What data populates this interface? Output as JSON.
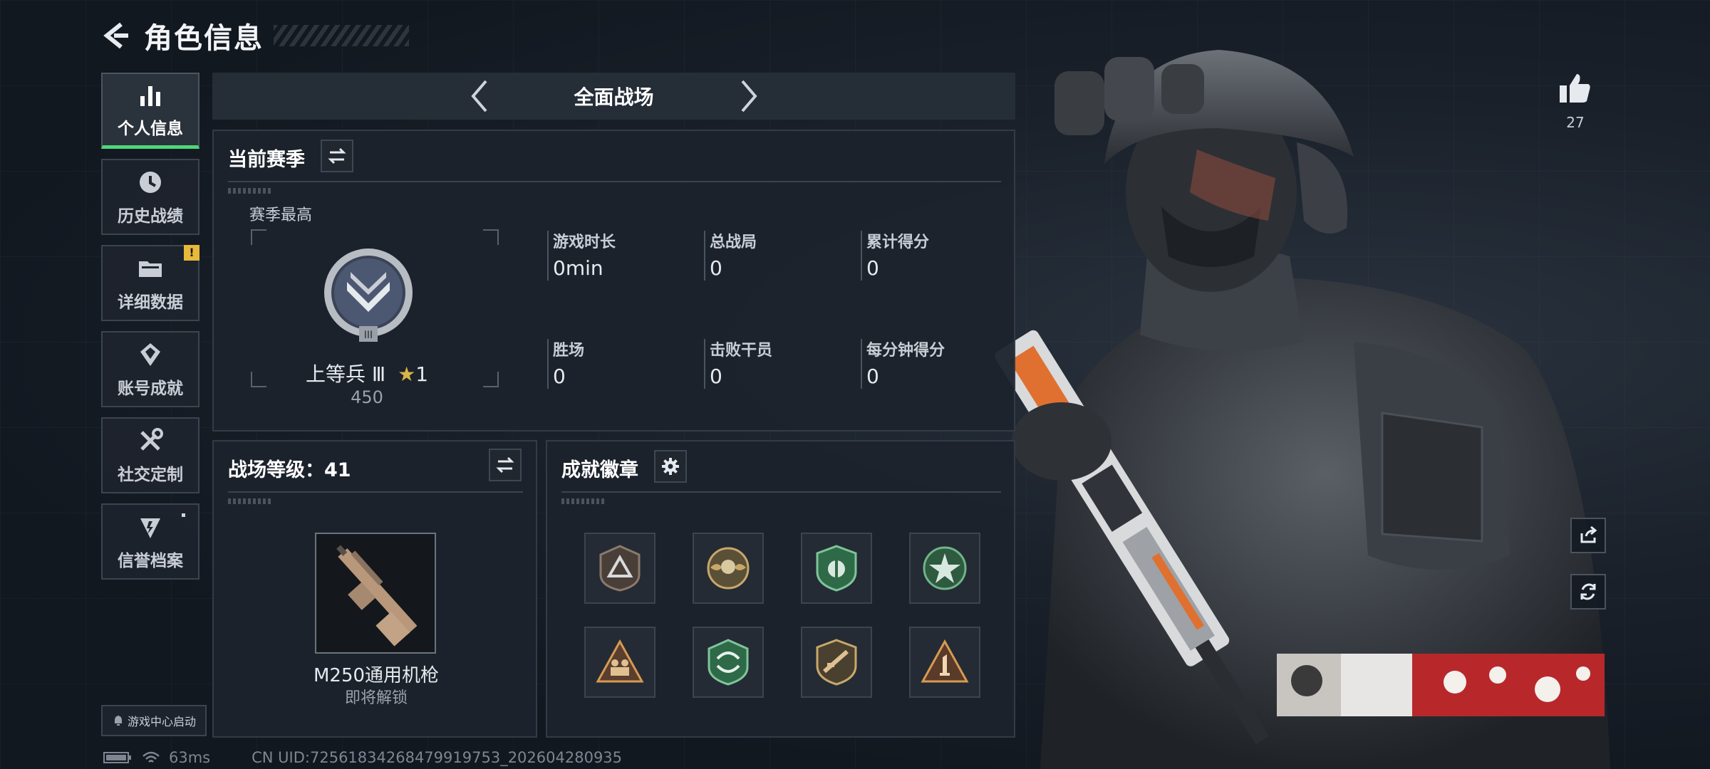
{
  "header": {
    "title": "角色信息"
  },
  "sidebar": {
    "items": [
      {
        "label": "个人信息",
        "icon": "bar-chart-icon",
        "active": true
      },
      {
        "label": "历史战绩",
        "icon": "clock-icon"
      },
      {
        "label": "详细数据",
        "icon": "folder-icon",
        "badge": "!"
      },
      {
        "label": "账号成就",
        "icon": "achievement-icon"
      },
      {
        "label": "社交定制",
        "icon": "tools-icon"
      },
      {
        "label": "信誉档案",
        "icon": "reputation-icon"
      }
    ],
    "game_center": "游戏中心启动"
  },
  "mode": {
    "title": "全面战场"
  },
  "season": {
    "title": "当前赛季",
    "best_label": "赛季最高",
    "rank_name": "上等兵 Ⅲ",
    "rank_stars": "1",
    "rank_points": "450",
    "stats": [
      {
        "label": "游戏时长",
        "value": "0min"
      },
      {
        "label": "总战局",
        "value": "0"
      },
      {
        "label": "累计得分",
        "value": "0"
      },
      {
        "label": "胜场",
        "value": "0"
      },
      {
        "label": "击败干员",
        "value": "0"
      },
      {
        "label": "每分钟得分",
        "value": "0"
      }
    ]
  },
  "battle_level": {
    "title": "战场等级：41",
    "weapon_name": "M250通用机枪",
    "weapon_status": "即将解锁"
  },
  "badges": {
    "title": "成就徽章",
    "items": [
      {
        "icon": "triangle-shield-badge-icon"
      },
      {
        "icon": "skull-wings-badge-icon"
      },
      {
        "icon": "green-shield-badge-icon"
      },
      {
        "icon": "green-star-badge-icon"
      },
      {
        "icon": "soldiers-triangle-badge-icon"
      },
      {
        "icon": "green-arrows-badge-icon"
      },
      {
        "icon": "rifle-shield-badge-icon"
      },
      {
        "icon": "number-one-triangle-badge-icon"
      }
    ]
  },
  "likes": {
    "count": "27"
  },
  "status": {
    "ping": "63ms",
    "uid": "CN UID:72561834268479919753_202604280935"
  },
  "colors": {
    "accent_green": "#4fd67a",
    "badge_yellow": "#e8b93a"
  }
}
